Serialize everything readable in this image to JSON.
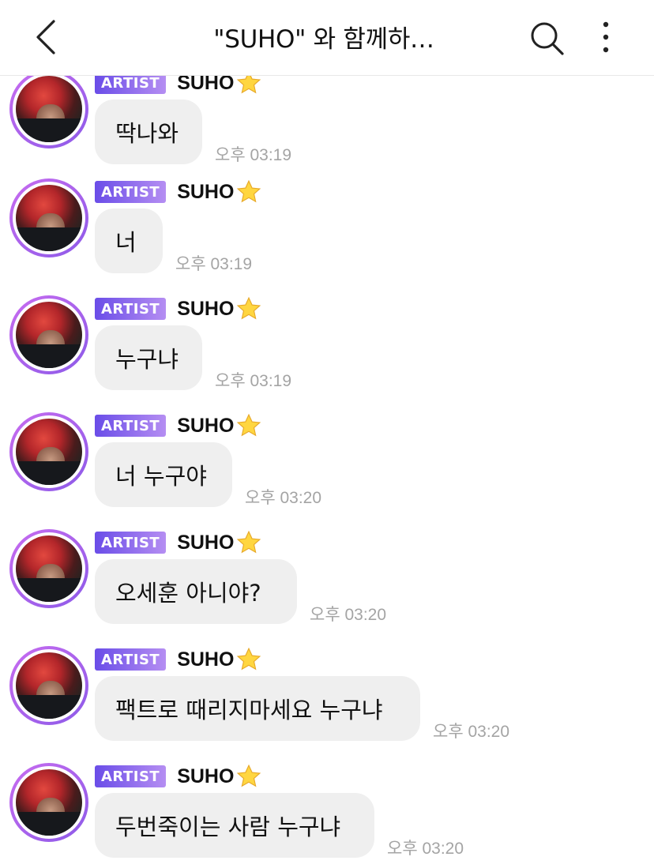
{
  "header": {
    "title": "\"SUHO\" 와 함께하…"
  },
  "messages": [
    {
      "badge": "ARTIST",
      "sender": "SUHO",
      "text": "딱나와",
      "time": "오후 03:19"
    },
    {
      "badge": "ARTIST",
      "sender": "SUHO",
      "text": "너",
      "time": "오후 03:19"
    },
    {
      "badge": "ARTIST",
      "sender": "SUHO",
      "text": "누구냐",
      "time": "오후 03:19"
    },
    {
      "badge": "ARTIST",
      "sender": "SUHO",
      "text": "너 누구야",
      "time": "오후 03:20"
    },
    {
      "badge": "ARTIST",
      "sender": "SUHO",
      "text": "오세훈 아니야?",
      "time": "오후 03:20"
    },
    {
      "badge": "ARTIST",
      "sender": "SUHO",
      "text": "팩트로 때리지마세요 누구냐",
      "time": "오후 03:20"
    },
    {
      "badge": "ARTIST",
      "sender": "SUHO",
      "text": "두번죽이는 사람 누구냐",
      "time": "오후 03:20"
    }
  ],
  "colors": {
    "badge_start": "#6a4de8",
    "badge_end": "#b58ef2",
    "bubble": "#efefef",
    "timestamp": "#a4a4a4"
  },
  "icons": [
    "back-icon",
    "search-icon",
    "more-icon",
    "star-icon"
  ]
}
